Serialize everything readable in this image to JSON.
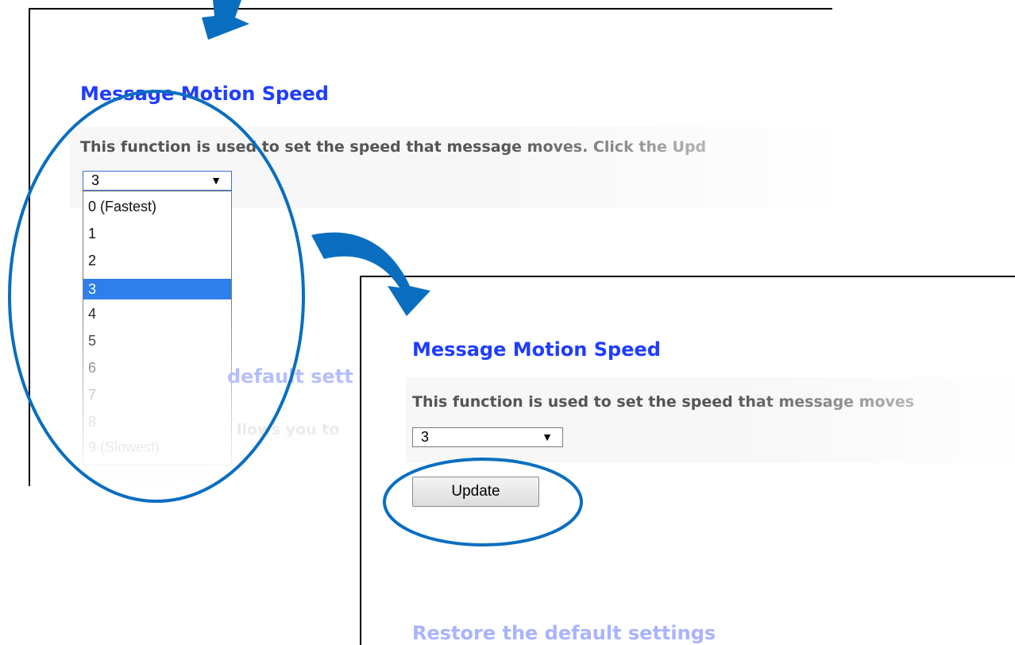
{
  "panel_left": {
    "heading": "Message Motion Speed",
    "description": "This function is used to set the speed that message moves. Click the Upd",
    "select_value": "3",
    "options": [
      "0 (Fastest)",
      "1",
      "2",
      "3",
      "4",
      "5",
      "6",
      "7",
      "8",
      "9 (Slowest)"
    ],
    "selected_option": "3",
    "second_heading_partial": "default sett",
    "second_desc_partial": "llows you to",
    "restore_button_partial": "Restore"
  },
  "panel_right": {
    "heading": "Message Motion Speed",
    "description": "This function is used to set the speed that message moves",
    "select_value": "3",
    "update_button": "Update",
    "restore_heading": "Restore the default settings"
  },
  "icons": {
    "dropdown_arrow": "▼"
  },
  "colors": {
    "heading": "#1f3cff",
    "annotation": "#0a6ec0",
    "selected_option": "#2e7fea"
  }
}
